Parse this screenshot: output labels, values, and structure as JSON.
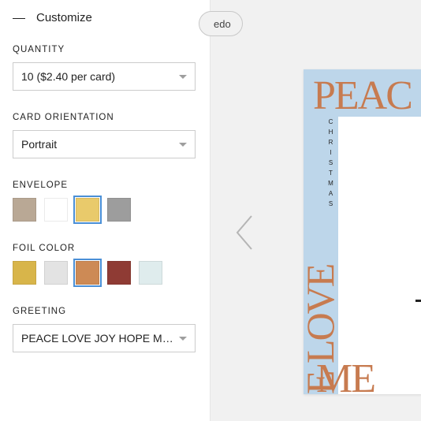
{
  "sidebar": {
    "title": "Customize",
    "quantity": {
      "label": "QUANTITY",
      "value": "10 ($2.40 per card)"
    },
    "orientation": {
      "label": "CARD ORIENTATION",
      "value": "Portrait"
    },
    "envelope": {
      "label": "ENVELOPE",
      "swatches": [
        "#b9a895",
        "#ffffff",
        "#e9ca6b",
        "#9d9d9d"
      ],
      "selected": 2
    },
    "foil": {
      "label": "FOIL COLOR",
      "swatches": [
        "#d8b54a",
        "#e3e3e3",
        "#cd8a55",
        "#8f3b34",
        "#dfeced"
      ],
      "selected": 2
    },
    "greeting": {
      "label": "GREETING",
      "value": "PEACE LOVE JOY HOPE ME…"
    }
  },
  "preview": {
    "pill": "edo",
    "card": {
      "top": "PEAC",
      "side": "E LOVE",
      "bottom": "ME",
      "small": "CHRISTMAS"
    }
  }
}
